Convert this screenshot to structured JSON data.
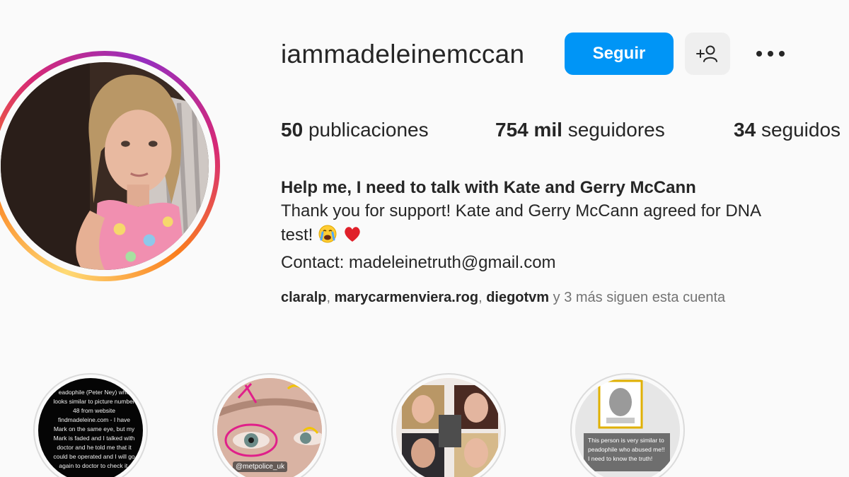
{
  "profile": {
    "username": "iammadeleinemccan",
    "follow_label": "Seguir",
    "suggest_icon": "add-person-icon",
    "more_icon": "more-options-icon"
  },
  "stats": {
    "posts_count": "50",
    "posts_label": "publicaciones",
    "followers_count": "754 mil",
    "followers_label": "seguidores",
    "following_count": "34",
    "following_label": "seguidos"
  },
  "bio": {
    "name": "Help me, I need to talk with Kate and Gerry McCann",
    "line1": "Thank you for support! Kate and Gerry McCann agreed for DNA",
    "line2": "test!",
    "emojis": [
      "crying-face-icon",
      "red-heart-icon"
    ],
    "contact": "Contact: madeleinetruth@gmail.com"
  },
  "followed_by": {
    "users": [
      "claralp",
      "marycarmenviera.rog",
      "diegotvm"
    ],
    "separator": ", ",
    "suffix": "y 3 más siguen esta cuenta"
  },
  "highlights": [
    {
      "text": "eadophile (Peter Ney) who looks similar to picture number 48 from website findmadeleine.com - I have Mark on the same eye, but my Mark is faded and I talked with doctor and he told me that it could be operated and I will go again to doctor to check it."
    },
    {
      "tag": "@metpolice_uk"
    },
    {},
    {
      "text": "This person is very similar to peadophile who abused me!! I need to know the truth!"
    }
  ],
  "colors": {
    "accent": "#0095f6",
    "text": "#262626",
    "secondary": "#737373",
    "background": "#fafafa"
  }
}
